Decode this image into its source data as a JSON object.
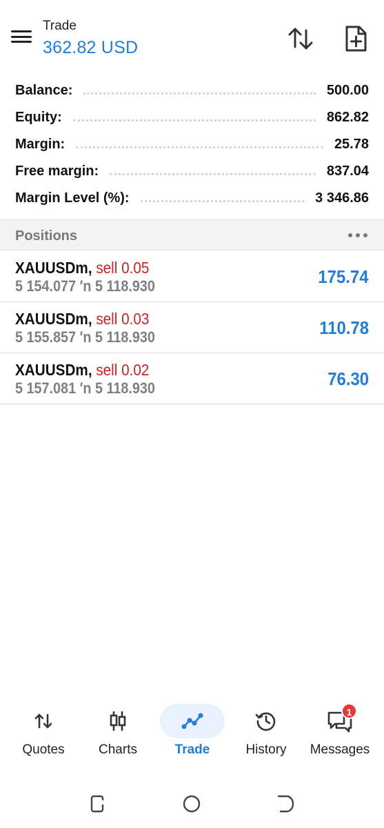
{
  "header": {
    "title": "Trade",
    "balance": "362.82 USD"
  },
  "summary": [
    {
      "label": "Balance:",
      "value": "500.00"
    },
    {
      "label": "Equity:",
      "value": "862.82"
    },
    {
      "label": "Margin:",
      "value": "25.78"
    },
    {
      "label": "Free margin:",
      "value": "837.04"
    },
    {
      "label": "Margin Level (%):",
      "value": "3 346.86"
    }
  ],
  "positions": {
    "title": "Positions",
    "items": [
      {
        "symbol": "XAUUSDm,",
        "side": "sell 0.05",
        "open_price": "5 154.077",
        "current_price": "5 118.930",
        "profit": "175.74"
      },
      {
        "symbol": "XAUUSDm,",
        "side": "sell 0.03",
        "open_price": "5 155.857",
        "current_price": "5 118.930",
        "profit": "110.78"
      },
      {
        "symbol": "XAUUSDm,",
        "side": "sell 0.02",
        "open_price": "5 157.081",
        "current_price": "5 118.930",
        "profit": "76.30"
      }
    ]
  },
  "bottom_nav": {
    "items": [
      {
        "label": "Quotes",
        "icon": "quotes-icon"
      },
      {
        "label": "Charts",
        "icon": "charts-icon"
      },
      {
        "label": "Trade",
        "icon": "trade-icon",
        "active": true
      },
      {
        "label": "History",
        "icon": "history-icon"
      },
      {
        "label": "Messages",
        "icon": "messages-icon",
        "badge": "1"
      }
    ]
  },
  "colors": {
    "accent": "#1f7de0",
    "sell": "#d21f1f",
    "badge": "#e53935"
  }
}
